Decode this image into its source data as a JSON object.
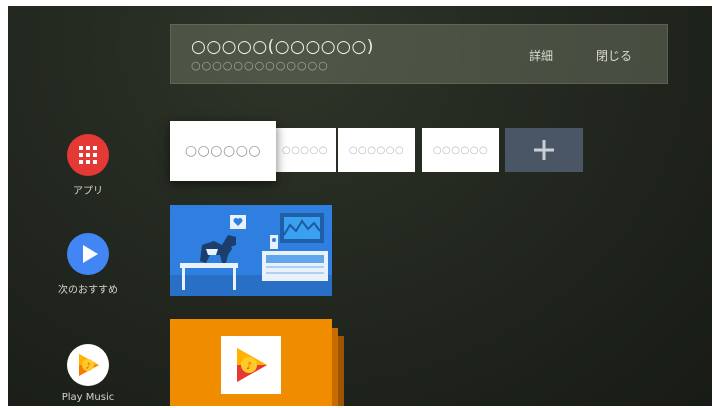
{
  "notification": {
    "title": "○○○○○(○○○○○○)",
    "subtitle": "○○○○○○○○○○○○○",
    "details_label": "詳細",
    "close_label": "閉じる"
  },
  "sidebar": {
    "items": [
      {
        "label": "アプリ",
        "icon": "apps-grid-icon",
        "color": "#e53935"
      },
      {
        "label": "次のおすすめ",
        "icon": "play-icon",
        "color": "#4285f4"
      },
      {
        "label": "Play Music",
        "icon": "play-music-icon",
        "color": "#ffffff"
      }
    ]
  },
  "apps_row": {
    "tiles": [
      {
        "label": "○○○○○○"
      },
      {
        "label": "○○○○○"
      },
      {
        "label": "○○○○○○"
      },
      {
        "label": "○○○○○○"
      }
    ],
    "add_icon": "plus-icon"
  },
  "colors": {
    "background": "#232820",
    "accent_red": "#e53935",
    "accent_blue": "#4285f4",
    "music_orange": "#f08c00",
    "add_tile": "#4a5666"
  }
}
